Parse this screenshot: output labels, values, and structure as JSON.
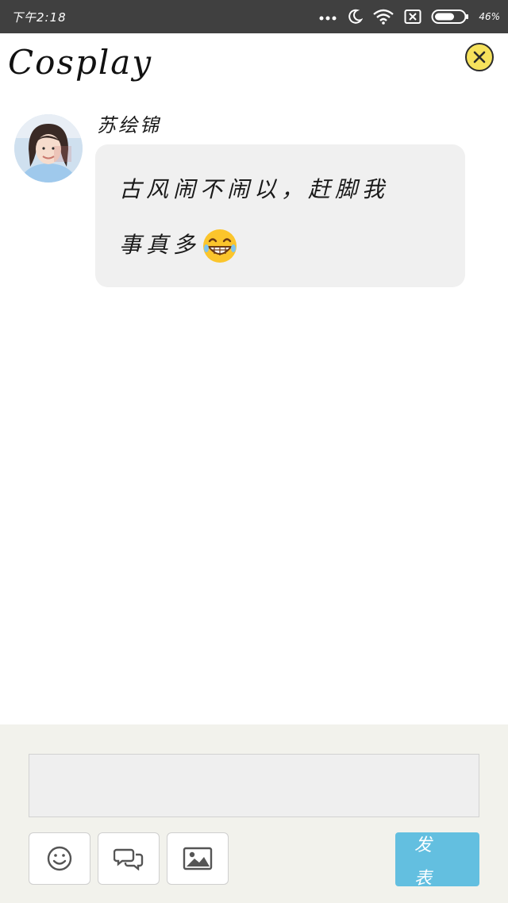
{
  "status_bar": {
    "time": "下午2:18",
    "battery_percent": "46%",
    "icons": [
      "more-dots-icon",
      "moon-icon",
      "wifi-icon",
      "sim-blocked-icon",
      "battery-icon"
    ]
  },
  "header": {
    "title": "Cosplay",
    "close_icon": "close-icon",
    "accent_color": "#f6e25c"
  },
  "message": {
    "sender_name": "苏绘锦",
    "text_line1": "古风闹不闹以，赶脚我",
    "text_line2": "事真多",
    "emoji": "grinning-face-emoji"
  },
  "composer": {
    "input_value": "",
    "tools": [
      "smiley-icon",
      "chat-bubbles-icon",
      "image-icon"
    ],
    "send_label": "发表",
    "send_color": "#63bfe0"
  }
}
